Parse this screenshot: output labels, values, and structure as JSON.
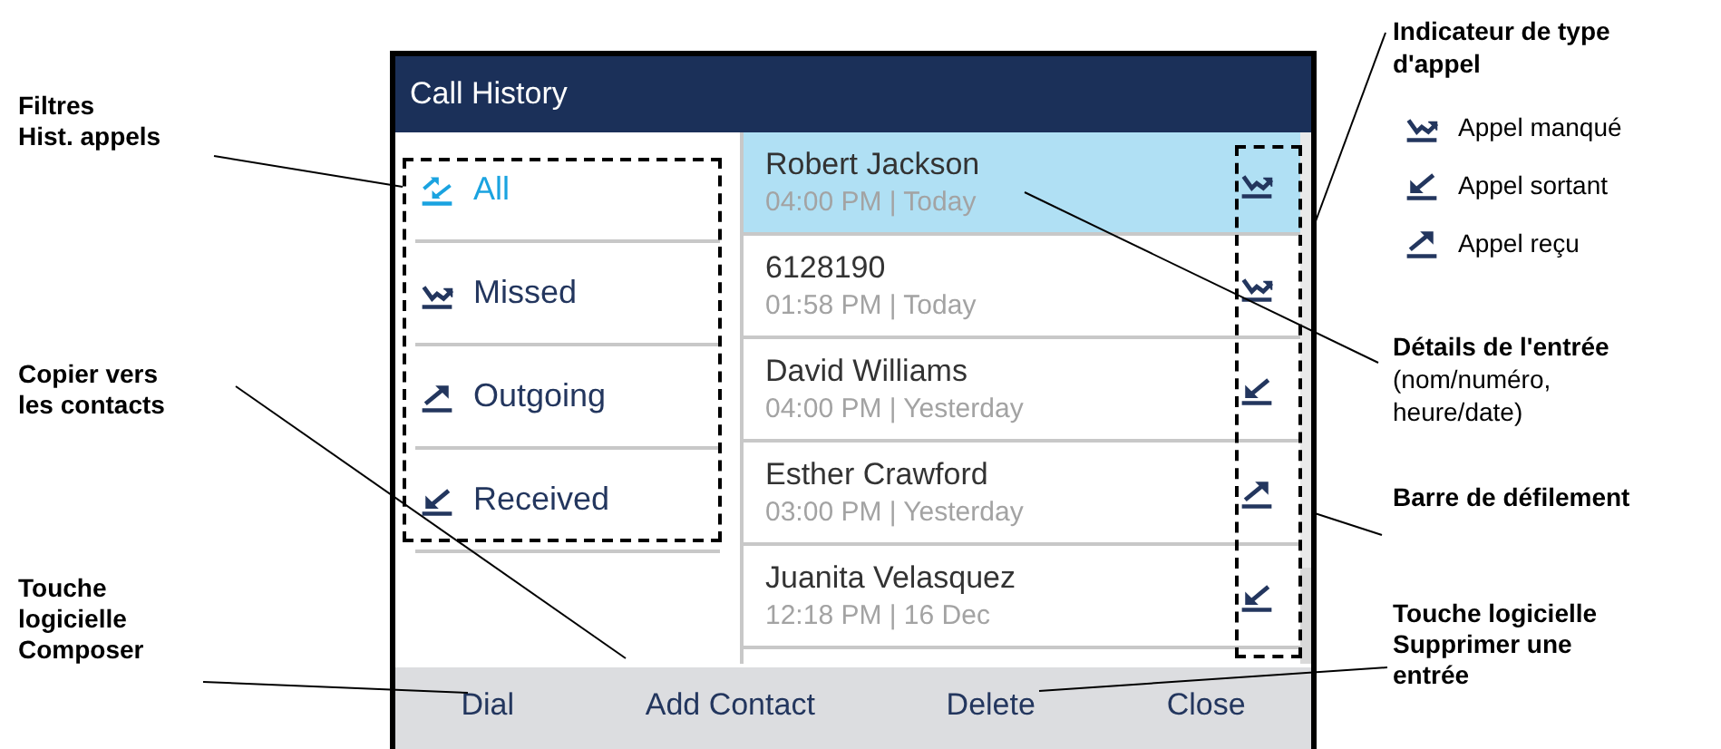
{
  "callouts_left": [
    {
      "text": "Filtres\nHist. appels"
    },
    {
      "text": "Copier vers\nles contacts"
    },
    {
      "text": "Touche\nlogicielle\nComposer"
    }
  ],
  "screen": {
    "title": "Call History",
    "filters": [
      {
        "label": "All",
        "kind": "all",
        "selected": true
      },
      {
        "label": "Missed",
        "kind": "missed",
        "selected": false
      },
      {
        "label": "Outgoing",
        "kind": "up_right",
        "selected": false
      },
      {
        "label": "Received",
        "kind": "down_left",
        "selected": false
      }
    ],
    "entries": [
      {
        "name": "Robert Jackson",
        "when": "04:00 PM | Today",
        "kind": "missed",
        "selected": true
      },
      {
        "name": "6128190",
        "when": "01:58 PM | Today",
        "kind": "missed",
        "selected": false
      },
      {
        "name": "David Williams",
        "when": "04:00 PM | Yesterday",
        "kind": "down_left",
        "selected": false
      },
      {
        "name": "Esther Crawford",
        "when": "03:00 PM | Yesterday",
        "kind": "up_right",
        "selected": false
      },
      {
        "name": "Juanita Velasquez",
        "when": "12:18 PM | 16 Dec",
        "kind": "down_left",
        "selected": false
      }
    ],
    "softkeys": [
      "Dial",
      "Add Contact",
      "Delete",
      "Close"
    ]
  },
  "type_indicator": {
    "title": "Indicateur de type\nd'appel",
    "legend": [
      {
        "kind": "missed",
        "label": "Appel manqué"
      },
      {
        "kind": "down_left",
        "label": "Appel sortant"
      },
      {
        "kind": "up_right",
        "label": "Appel reçu"
      }
    ]
  },
  "entry_details": {
    "title": "Détails de l'entrée",
    "note": "(nom/numéro,\nheure/date)"
  },
  "scrollbar_label": "Barre de défilement",
  "delete_label": "Touche logicielle\nSupprimer une\nentrée"
}
